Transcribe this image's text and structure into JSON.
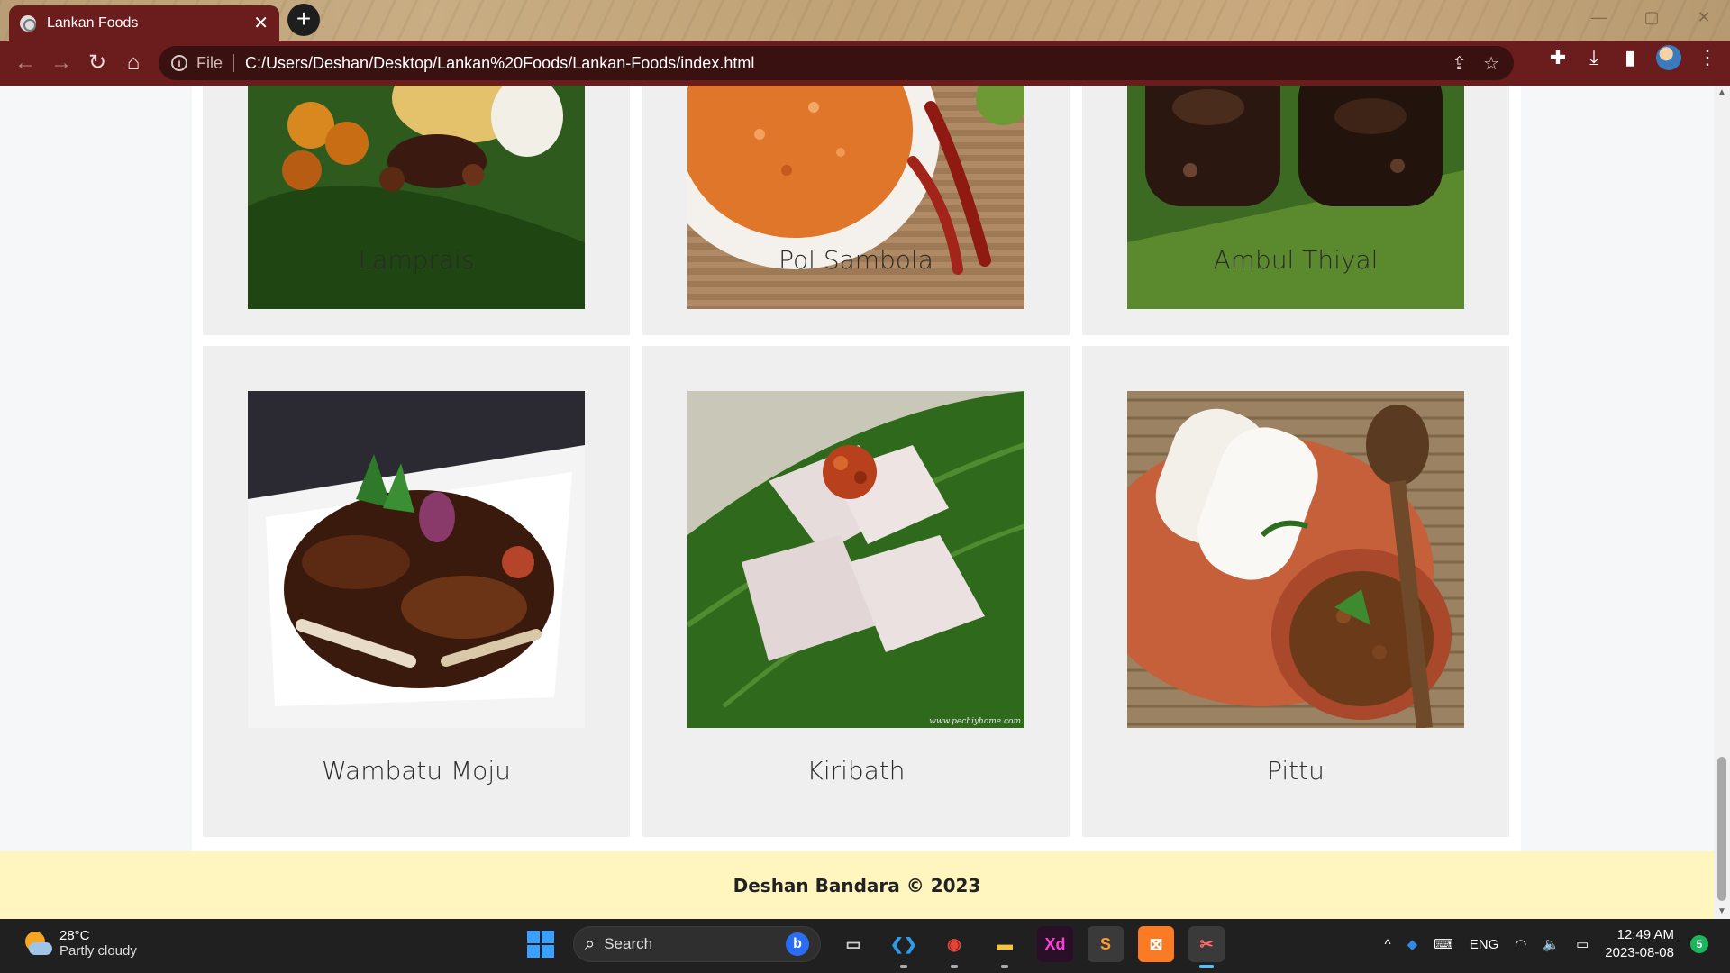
{
  "browser": {
    "tab_title": "Lankan Foods",
    "tab_close": "✕",
    "new_tab": "+",
    "window_controls": [
      "—",
      "▢",
      "✕"
    ],
    "nav": {
      "back": "←",
      "forward": "→",
      "reload": "↻",
      "home": "⌂"
    },
    "address": {
      "info": "i",
      "scheme": "File",
      "url": "C:/Users/Deshan/Desktop/Lankan%20Foods/Lankan-Foods/index.html"
    },
    "omnibox_icons": {
      "share": "⇪",
      "star": "☆"
    },
    "toolbar_icons": {
      "extensions": "✚",
      "download": "⤓",
      "sidepanel": "▮",
      "menu": "⋮"
    }
  },
  "foods": [
    {
      "name": "Lamprais",
      "image": "lamprais-image"
    },
    {
      "name": "Pol Sambola",
      "image": "pol-sambola-image"
    },
    {
      "name": "Ambul Thiyal",
      "image": "ambul-thiyal-image"
    },
    {
      "name": "Wambatu Moju",
      "image": "wambatu-moju-image"
    },
    {
      "name": "Kiribath",
      "image": "kiribath-image"
    },
    {
      "name": "Pittu",
      "image": "pittu-image"
    }
  ],
  "image_watermark": "www.pechiyhome.com",
  "footer": {
    "text": "Deshan Bandara © 2023"
  },
  "taskbar": {
    "weather": {
      "temp": "28°C",
      "condition": "Partly cloudy"
    },
    "search_placeholder": "Search",
    "bing_label": "b",
    "apps": [
      {
        "name": "file-manager",
        "label": "▭"
      },
      {
        "name": "vscode",
        "label": "❮❯"
      },
      {
        "name": "chrome",
        "label": "◉"
      },
      {
        "name": "file-explorer",
        "label": "▬"
      },
      {
        "name": "adobe-xd",
        "label": "Xd"
      },
      {
        "name": "sublime-text",
        "label": "S"
      },
      {
        "name": "xampp",
        "label": "⊠"
      },
      {
        "name": "snipping-tool",
        "label": "✂"
      }
    ],
    "tray": {
      "chevron": "^",
      "keyboard": "⌨",
      "lang": "ENG",
      "wifi": "◠",
      "volume": "🔈",
      "battery": "▭",
      "time": "12:49 AM",
      "date": "2023-08-08",
      "notifications": "5"
    }
  },
  "colors": {
    "chrome": "#6b1d1d",
    "omnibox": "#3a1111",
    "card": "#efefef",
    "footer": "#fff6bf",
    "taskbar": "#202020"
  }
}
